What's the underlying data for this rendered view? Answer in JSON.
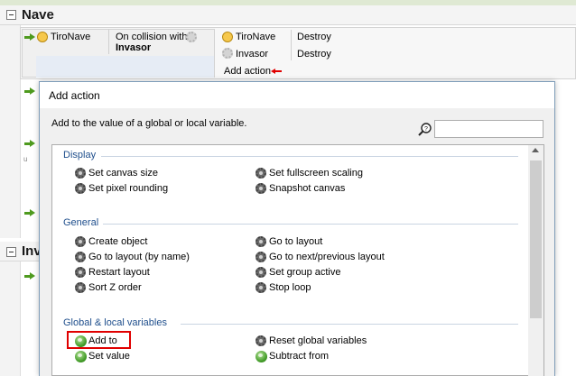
{
  "event_sheet": {
    "group_nave": {
      "title": "Nave"
    },
    "group_inv": {
      "title": "Inv"
    },
    "event1": {
      "condition_object": "TiroNave",
      "condition_text_line1": "On collision with",
      "condition_text_line2": "Invasor",
      "actions": [
        {
          "object": "TiroNave",
          "action": "Destroy"
        },
        {
          "object": "Invasor",
          "action": "Destroy"
        }
      ],
      "add_action_label": "Add action"
    },
    "partial_letter": "u"
  },
  "dialog": {
    "title": "Add action",
    "description": "Add to the value of a global or local variable.",
    "search": {
      "value": "",
      "placeholder": ""
    },
    "categories": [
      {
        "name": "Display",
        "left": [
          "Set canvas size",
          "Set pixel rounding"
        ],
        "right": [
          "Set fullscreen scaling",
          "Snapshot canvas"
        ]
      },
      {
        "name": "General",
        "left": [
          "Create object",
          "Go to layout (by name)",
          "Restart layout",
          "Sort Z order"
        ],
        "right": [
          "Go to layout",
          "Go to next/previous layout",
          "Set group active",
          "Stop loop"
        ]
      },
      {
        "name": "Global & local variables",
        "left": [
          "Add to",
          "Set value"
        ],
        "right": [
          "Reset global variables",
          "Subtract from"
        ]
      }
    ]
  }
}
